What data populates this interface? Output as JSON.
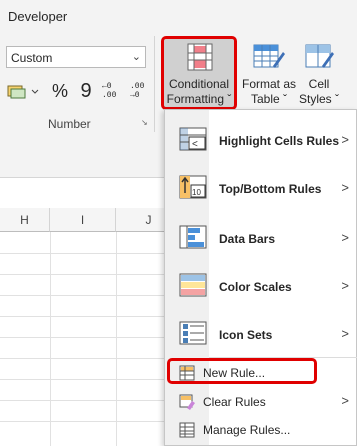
{
  "ribbon": {
    "tab_label": "Developer",
    "number_group": {
      "format_value": "Custom",
      "percent_label": "%",
      "comma_label": "9",
      "increase_decimal_label": "←0 .00",
      "decrease_decimal_label": ".00 →0",
      "group_label": "Number"
    },
    "conditional_formatting": {
      "line1": "Conditional",
      "line2": "Formatting ˇ"
    },
    "format_as_table": {
      "line1": "Format as",
      "line2": "Table ˇ"
    },
    "cell_styles": {
      "line1": "Cell",
      "line2": "Styles ˇ"
    }
  },
  "grid": {
    "columns": [
      "H",
      "I",
      "J"
    ]
  },
  "menu": {
    "items": [
      {
        "label": "Highlight Cells Rules",
        "has_submenu": true,
        "icon": "highlight-cells-icon"
      },
      {
        "label": "Top/Bottom Rules",
        "has_submenu": true,
        "icon": "top-bottom-icon"
      },
      {
        "label": "Data Bars",
        "has_submenu": true,
        "icon": "data-bars-icon"
      },
      {
        "label": "Color Scales",
        "has_submenu": true,
        "icon": "color-scales-icon"
      },
      {
        "label": "Icon Sets",
        "has_submenu": true,
        "icon": "icon-sets-icon"
      }
    ],
    "actions": [
      {
        "label": "New Rule...",
        "icon": "new-rule-icon"
      },
      {
        "label": "Clear Rules",
        "has_submenu": true,
        "icon": "clear-rules-icon"
      },
      {
        "label": "Manage Rules...",
        "icon": "manage-rules-icon"
      }
    ],
    "chevron": ">"
  },
  "colors": {
    "highlight_border": "#e00000",
    "pressed_button": "#d0d0d0"
  }
}
